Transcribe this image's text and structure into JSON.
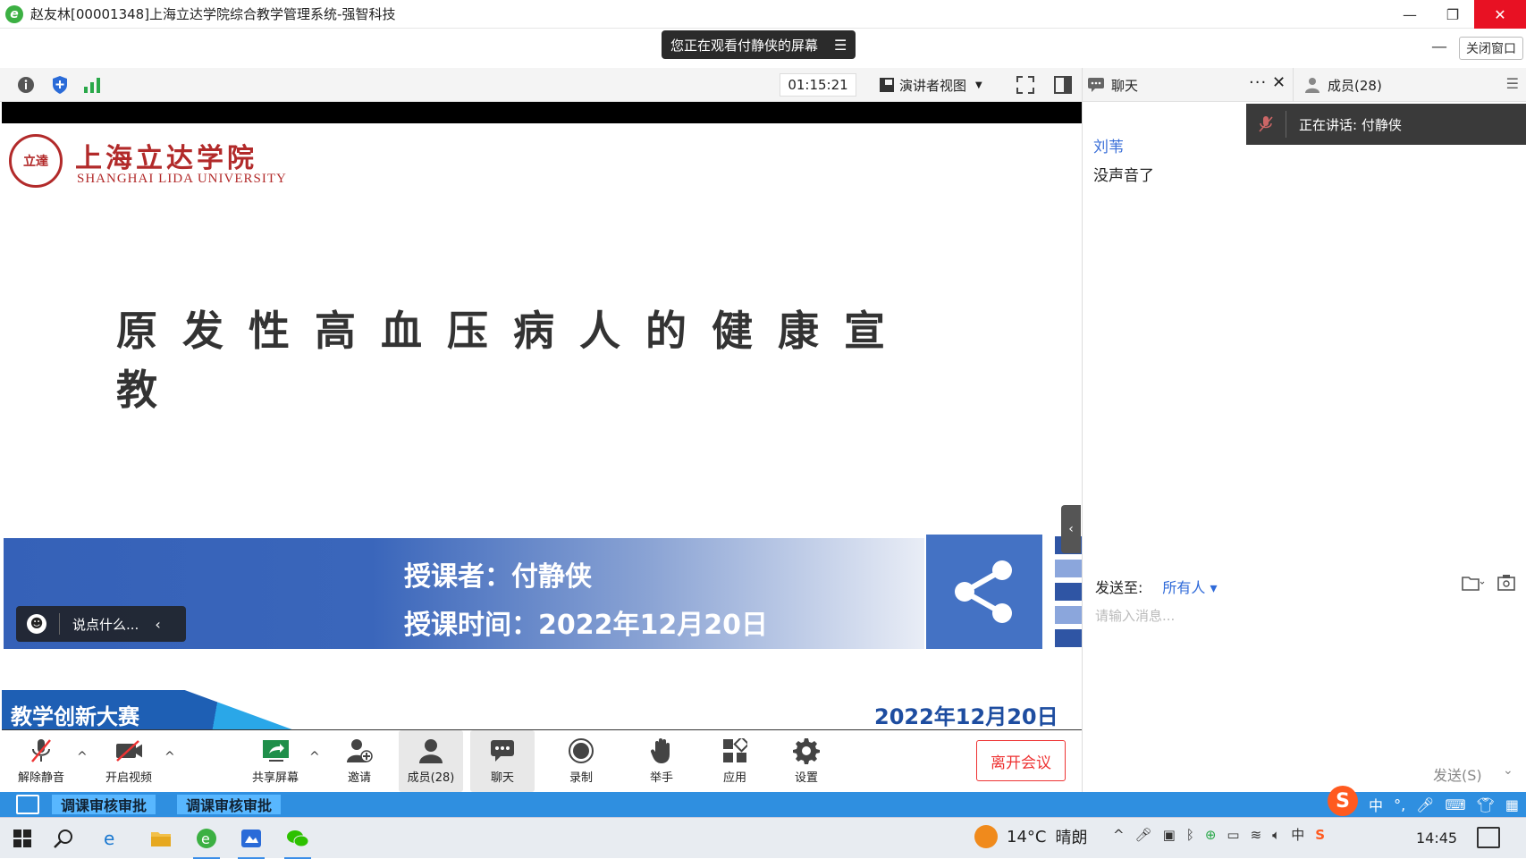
{
  "window": {
    "title": "赵友林[00001348]上海立达学院综合教学管理系统-强智科技",
    "btn_min": "—",
    "btn_restore": "❐",
    "btn_close": "✕"
  },
  "banner": {
    "viewing_text": "您正在观看付静侠的屏幕",
    "menu_glyph": "☰",
    "close_window": "关闭窗口"
  },
  "toolbar": {
    "timer": "01:15:21",
    "presenter_view": "演讲者视图"
  },
  "panel": {
    "chat_tab": "聊天",
    "more": "···",
    "close": "✕",
    "members_tab": "成员(28)"
  },
  "slide": {
    "logo_seal": "立達",
    "logo_cn": "上海立达学院",
    "logo_en": "SHANGHAI LIDA UNIVERSITY",
    "title": "原发性高血压病人的健康宣教",
    "lecturer": "授课者：付静侠",
    "lecture_time": "授课时间：2022年12月20日",
    "contest": "教学创新大赛",
    "date": "2022年12月20日",
    "say_placeholder": "说点什么..."
  },
  "chat": {
    "speaking": "正在讲话: 付静侠",
    "messages": [
      {
        "sender": "刘苇",
        "text": "没声音了"
      }
    ],
    "send_to_label": "发送至:",
    "send_to_target": "所有人",
    "input_placeholder": "请输入消息...",
    "send_button": "发送(S)"
  },
  "controls": {
    "unmute": "解除静音",
    "start_video": "开启视频",
    "share_screen": "共享屏幕",
    "invite": "邀请",
    "members": "成员(28)",
    "chat": "聊天",
    "record": "录制",
    "raise_hand": "举手",
    "apps": "应用",
    "settings": "设置",
    "leave": "离开会议"
  },
  "subbar": {
    "tab1": "调课审核审批",
    "tab2": "调课审核审批",
    "ime_mode": "中"
  },
  "taskbar": {
    "temperature": "14°C",
    "weather": "晴朗",
    "tray_ime": "中",
    "clock": "14:45"
  },
  "colors": {
    "accent_blue": "#2f8fe0",
    "leave_red": "#ee3333",
    "slide_blue": "#3561b8",
    "brand_red": "#b22a2a"
  }
}
